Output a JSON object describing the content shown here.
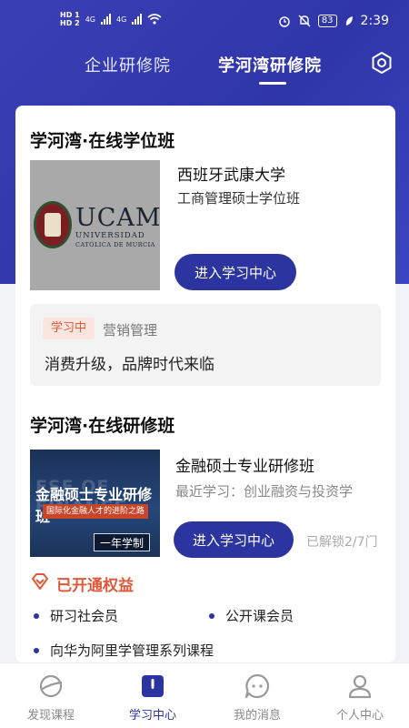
{
  "status_bar": {
    "left": [
      "HD 1",
      "HD 2",
      "4G",
      "4G"
    ],
    "battery": "83",
    "time": "2:39"
  },
  "tabs": [
    {
      "label": "企业研修院"
    },
    {
      "label": "学河湾研修院"
    }
  ],
  "degree_section": {
    "title": "学河湾·在线学位班",
    "thumbnail": {
      "logo_big": "UCAM",
      "logo_line1": "UNIVERSIDAD",
      "logo_line2": "CATÓLICA DE MURCIA"
    },
    "university": "西班牙武康大学",
    "program": "工商管理硕士学位班",
    "enter_button": "进入学习中心",
    "studying": {
      "badge": "学习中",
      "course": "营销管理",
      "lesson": "消费升级，品牌时代来临"
    }
  },
  "training_section": {
    "title": "学河湾·在线研修班",
    "thumbnail": {
      "ghost": "ESE OF FINANCE",
      "title": "金融硕士专业研修班",
      "subtitle": "国际化金融人才的进阶之路",
      "tag": "一年学制"
    },
    "program": "金融硕士专业研修班",
    "recent": "最近学习：创业融资与投资学",
    "enter_button": "进入学习中心",
    "unlock": "已解锁2/7门"
  },
  "benefits": {
    "title": "已开通权益",
    "items": [
      "研习社会员",
      "公开课会员",
      "向华为阿里学管理系列课程"
    ]
  },
  "bottom_nav": [
    {
      "label": "发现课程"
    },
    {
      "label": "学习中心"
    },
    {
      "label": "我的消息"
    },
    {
      "label": "个人中心"
    }
  ],
  "colors": {
    "brand": "#2c34a0",
    "accent": "#e0583a"
  }
}
